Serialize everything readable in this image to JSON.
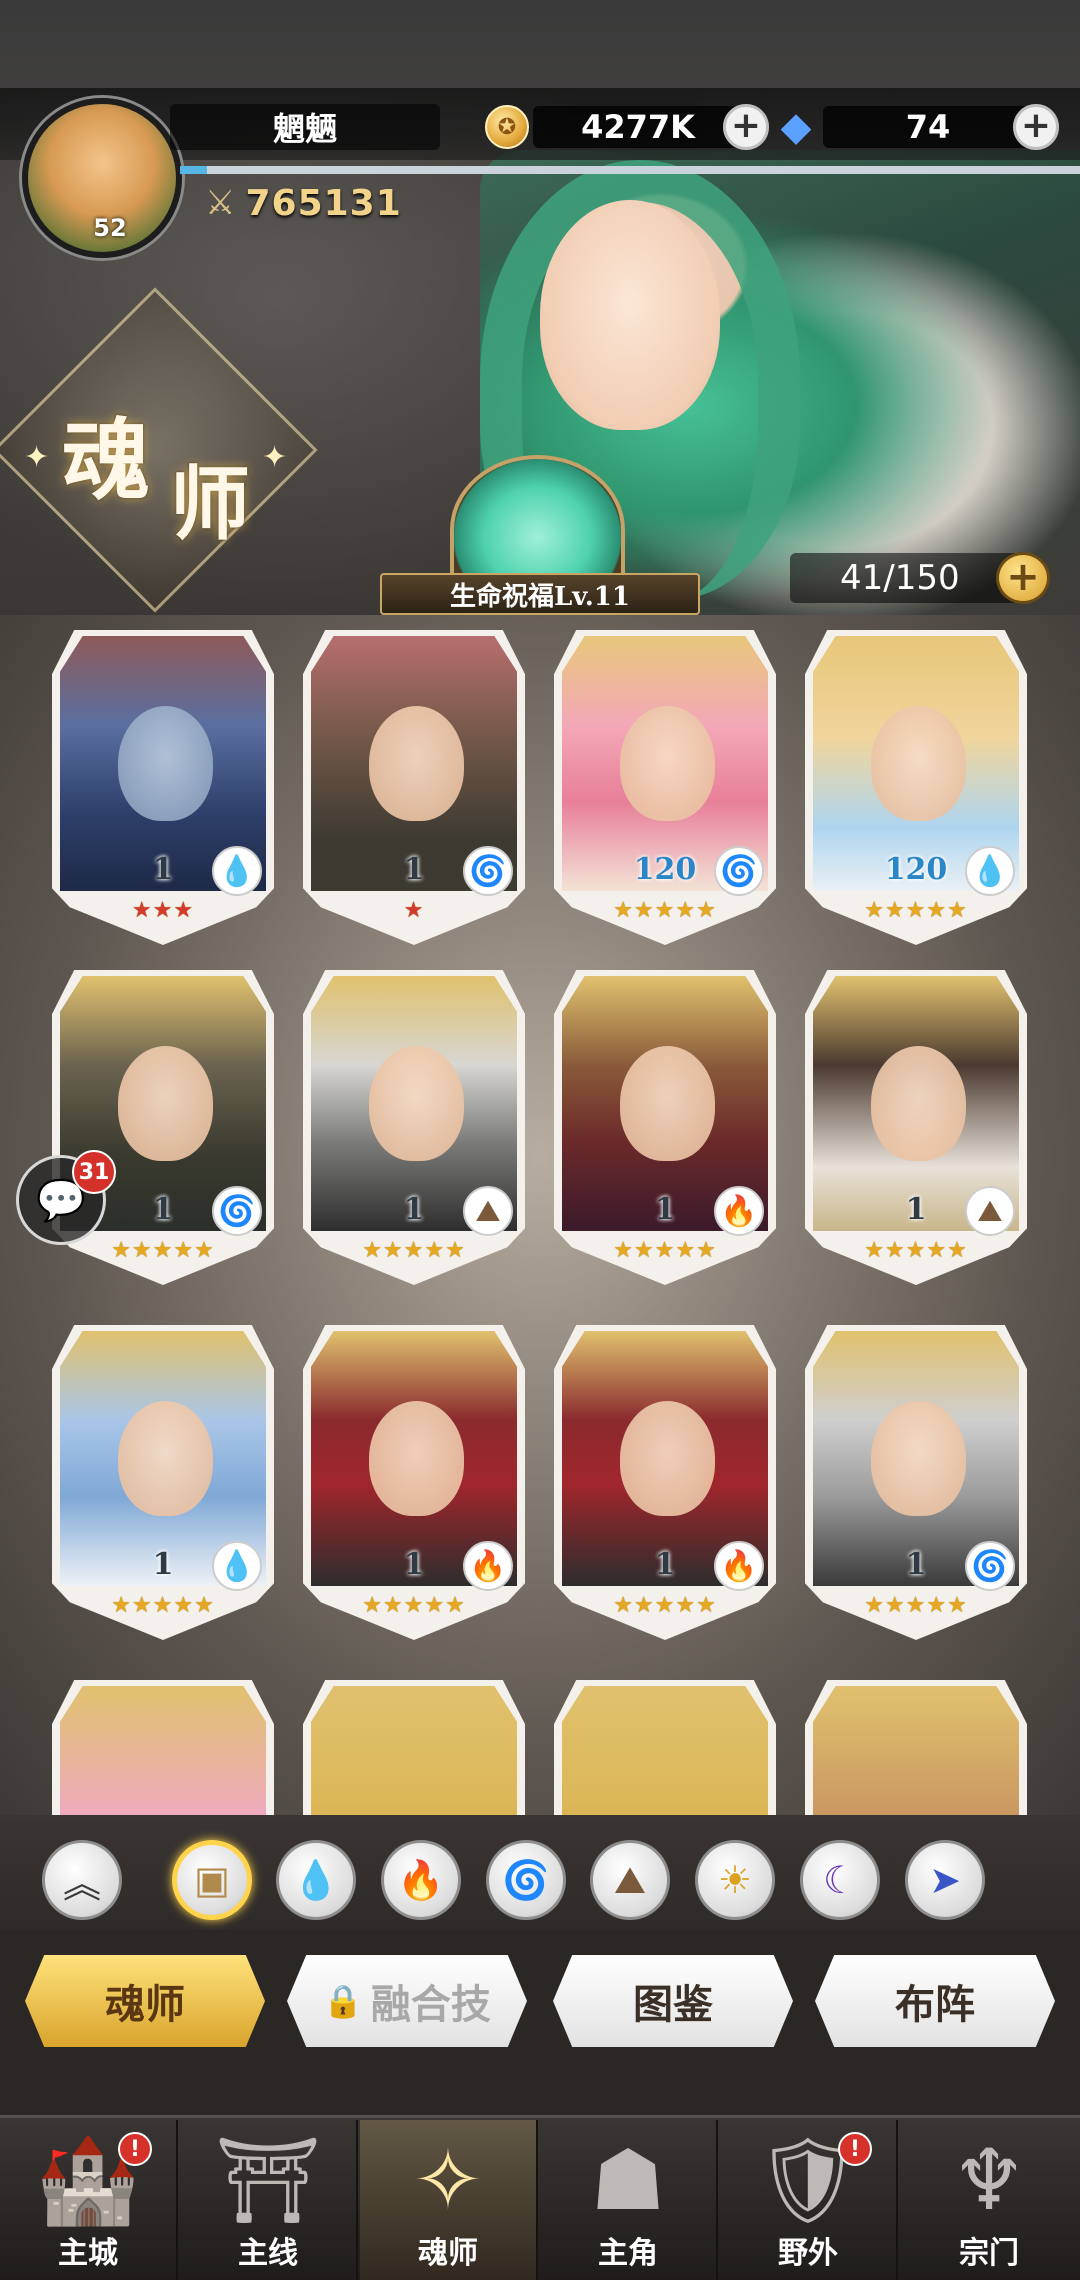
{
  "header": {
    "player_name": "魍魉",
    "avatar_level": "52",
    "combat_power": "765131",
    "gold": "4277K",
    "gems": "74",
    "xp_progress": 0.03
  },
  "banner": {
    "title_char_1": "魂",
    "title_char_2": "师",
    "blessing_label": "生命祝福Lv.11",
    "capacity": "41/150"
  },
  "cards": [
    {
      "level": "1",
      "element": "water",
      "stars": "★★★",
      "star_color": "red"
    },
    {
      "level": "1",
      "element": "wind",
      "stars": "★",
      "star_color": "red"
    },
    {
      "level": "120",
      "element": "wind",
      "stars": "★★★★★",
      "star_color": "gold"
    },
    {
      "level": "120",
      "element": "water",
      "stars": "★★★★★",
      "star_color": "gold"
    },
    {
      "level": "1",
      "element": "wind",
      "stars": "★★★★★",
      "star_color": "gold"
    },
    {
      "level": "1",
      "element": "earth",
      "stars": "★★★★★",
      "star_color": "gold"
    },
    {
      "level": "1",
      "element": "fire",
      "stars": "★★★★★",
      "star_color": "gold"
    },
    {
      "level": "1",
      "element": "earth",
      "stars": "★★★★★",
      "star_color": "gold"
    },
    {
      "level": "1",
      "element": "water",
      "stars": "★★★★★",
      "star_color": "gold"
    },
    {
      "level": "1",
      "element": "fire",
      "stars": "★★★★★",
      "star_color": "gold"
    },
    {
      "level": "1",
      "element": "fire",
      "stars": "★★★★★",
      "star_color": "gold"
    },
    {
      "level": "1",
      "element": "wind",
      "stars": "★★★★★",
      "star_color": "gold"
    }
  ],
  "chat": {
    "unread": "31"
  },
  "filters": [
    "all-rank",
    "all-box",
    "water",
    "fire",
    "wind",
    "earth",
    "light",
    "dark",
    "void"
  ],
  "tabs": {
    "soul_master": "魂师",
    "fusion_skill": "融合技",
    "codex": "图鉴",
    "formation": "布阵"
  },
  "nav": {
    "main_city": "主城",
    "main_line": "主线",
    "soul_master": "魂师",
    "protagonist": "主角",
    "wild": "野外",
    "sect": "宗门",
    "badge_mark": "!"
  },
  "colors": {
    "gold_accent": "#ffd34a",
    "level_high": "#2a86c7",
    "badge_red": "#d3312a"
  }
}
